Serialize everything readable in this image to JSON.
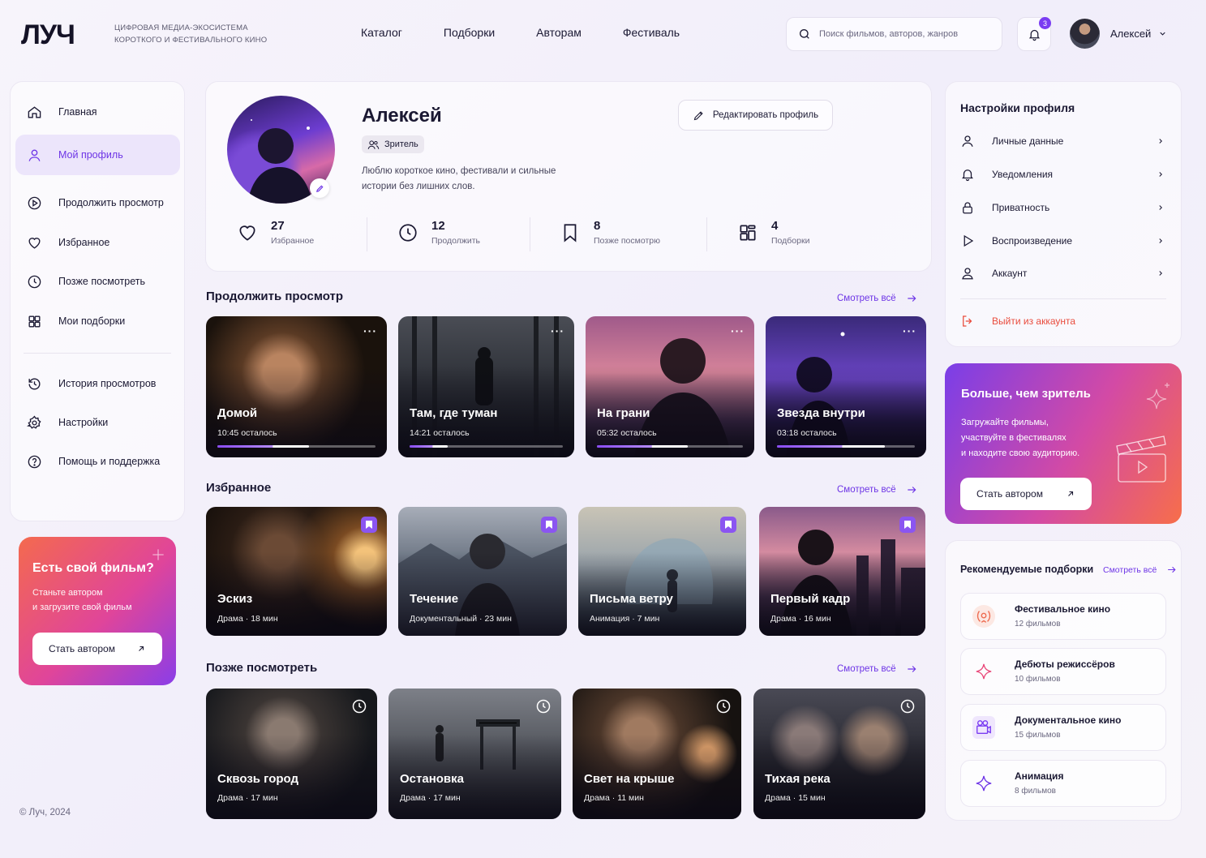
{
  "brand": {
    "logo": "ЛУЧ",
    "tagline_1": "ЦИФРОВАЯ МЕДИА-ЭКОСИСТЕМА",
    "tagline_2": "КОРОТКОГО И ФЕСТИВАЛЬНОГО КИНО",
    "accent": "#7a3cf2"
  },
  "topnav": [
    "Каталог",
    "Подборки",
    "Авторам",
    "Фестиваль"
  ],
  "search": {
    "placeholder": "Поиск фильмов, авторов, жанров"
  },
  "notifications": {
    "count": "3"
  },
  "user": {
    "name": "Алексей"
  },
  "sidebar": {
    "items": [
      {
        "label": "Главная",
        "icon": "home-icon"
      },
      {
        "label": "Мой профиль",
        "icon": "user-icon",
        "active": true
      },
      {
        "label": "Продолжить просмотр",
        "icon": "play-circle-icon"
      },
      {
        "label": "Избранное",
        "icon": "heart-icon"
      },
      {
        "label": "Позже посмотреть",
        "icon": "clock-icon"
      },
      {
        "label": "Мои подборки",
        "icon": "grid-icon"
      },
      {
        "label": "История просмотров",
        "icon": "history-icon"
      },
      {
        "label": "Настройки",
        "icon": "gear-icon"
      },
      {
        "label": "Помощь и поддержка",
        "icon": "help-icon"
      }
    ],
    "promo": {
      "title": "Есть свой фильм?",
      "text_1": "Станьте автором",
      "text_2": "и загрузите свой фильм",
      "button": "Стать автором"
    },
    "copyright": "© Луч, 2024"
  },
  "profile": {
    "name": "Алексей",
    "role": "Зритель",
    "bio_1": "Люблю короткое кино, фестивали и сильные",
    "bio_2": "истории без лишних слов.",
    "edit_label": "Редактировать профиль",
    "stats": [
      {
        "value": "27",
        "label": "Избранное"
      },
      {
        "value": "12",
        "label": "Продолжить"
      },
      {
        "value": "8",
        "label": "Позже посмотрю"
      },
      {
        "value": "4",
        "label": "Подборки"
      }
    ]
  },
  "see_all": "Смотреть всё",
  "continue": {
    "title": "Продолжить просмотр",
    "items": [
      {
        "title": "Домой",
        "sub": "10:45 осталось",
        "progress": 0.58
      },
      {
        "title": "Там, где туман",
        "sub": "14:21 осталось",
        "progress": 0.25
      },
      {
        "title": "На грани",
        "sub": "05:32 осталось",
        "progress": 0.62
      },
      {
        "title": "Звезда внутри",
        "sub": "03:18 осталось",
        "progress": 0.78
      }
    ]
  },
  "favorites": {
    "title": "Избранное",
    "items": [
      {
        "title": "Эскиз",
        "genre": "Драма",
        "dur": "18 мин"
      },
      {
        "title": "Течение",
        "genre": "Документальный",
        "dur": "23 мин"
      },
      {
        "title": "Письма ветру",
        "genre": "Анимация",
        "dur": "7 мин"
      },
      {
        "title": "Первый кадр",
        "genre": "Драма",
        "dur": "16 мин"
      }
    ]
  },
  "later": {
    "title": "Позже посмотреть",
    "items": [
      {
        "title": "Сквозь город",
        "genre": "Драма",
        "dur": "17 мин"
      },
      {
        "title": "Остановка",
        "genre": "Драма",
        "dur": "17 мин"
      },
      {
        "title": "Свет на крыше",
        "genre": "Драма",
        "dur": "11 мин"
      },
      {
        "title": "Тихая река",
        "genre": "Драма",
        "dur": "15 мин"
      }
    ]
  },
  "settings": {
    "title": "Настройки профиля",
    "items": [
      "Личные данные",
      "Уведомления",
      "Приватность",
      "Воспроизведение",
      "Аккаунт"
    ],
    "logout": "Выйти из аккаунта"
  },
  "author_promo": {
    "title": "Больше, чем зритель",
    "text_1": "Загружайте фильмы,",
    "text_2": "участвуйте в фестивалях",
    "text_3": "и находите свою аудиторию.",
    "button": "Стать автором"
  },
  "reco": {
    "title": "Рекомендуемые подборки",
    "items": [
      {
        "title": "Фестивальное кино",
        "count": "12 фильмов",
        "icon": "laurel-icon"
      },
      {
        "title": "Дебюты режиссёров",
        "count": "10 фильмов",
        "icon": "sparkle-icon"
      },
      {
        "title": "Документальное кино",
        "count": "15 фильмов",
        "icon": "camera-icon"
      },
      {
        "title": "Анимация",
        "count": "8 фильмов",
        "icon": "star-icon"
      }
    ]
  }
}
